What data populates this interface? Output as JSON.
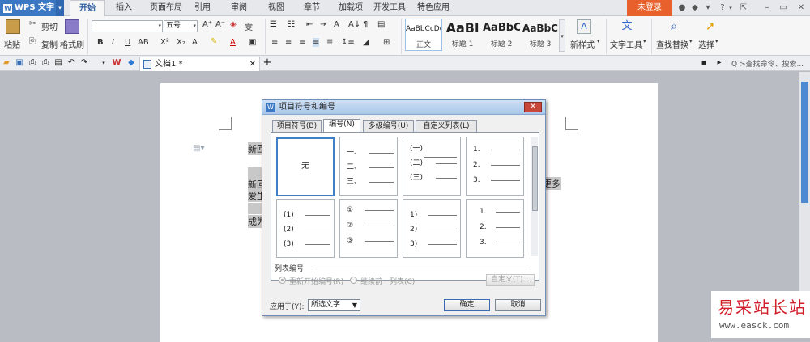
{
  "app": {
    "name": "WPS 文字",
    "tabs": [
      "开始",
      "插入",
      "页面布局",
      "引用",
      "审阅",
      "视图",
      "章节",
      "加载项",
      "开发工具",
      "特色应用"
    ],
    "active_tab": "开始",
    "login_label": "未登录"
  },
  "ribbon": {
    "paste": "粘贴",
    "cut": "剪切",
    "copy": "复制",
    "format_painter": "格式刷",
    "font_name": "",
    "font_size": "五号",
    "bold": "B",
    "italic": "I",
    "underline": "U",
    "styles": [
      {
        "preview": "AaBbCcDd",
        "name": "正文"
      },
      {
        "preview": "AaBl",
        "name": "标题 1"
      },
      {
        "preview": "AaBbC",
        "name": "标题 2"
      },
      {
        "preview": "AaBbC",
        "name": "标题 3"
      }
    ],
    "new_style": "新样式",
    "text_tools": "文字工具",
    "find_replace": "查找替换",
    "select": "选择"
  },
  "docbar": {
    "doc_tab": "文档1 *",
    "search_placeholder": "Q >查找命令、搜索..."
  },
  "page": {
    "paragraphs": [
      "新回",
      "新回",
      "爱生",
      "成为",
      "更多"
    ]
  },
  "dialog": {
    "title": "项目符号和编号",
    "tabs": [
      "项目符号(B)",
      "编号(N)",
      "多级编号(U)",
      "自定义列表(L)"
    ],
    "active_tab": "编号(N)",
    "gallery": [
      {
        "type": "none",
        "label": "无"
      },
      {
        "type": "list",
        "items": [
          "一、",
          "二、",
          "三、"
        ]
      },
      {
        "type": "list",
        "items": [
          "(一)",
          "(二)",
          "(三)"
        ]
      },
      {
        "type": "list",
        "items": [
          "1.",
          "2.",
          "3."
        ]
      },
      {
        "type": "list",
        "items": [
          "(1)",
          "(2)",
          "(3)"
        ]
      },
      {
        "type": "list",
        "items": [
          "①",
          "②",
          "③"
        ]
      },
      {
        "type": "list",
        "items": [
          "1)",
          "2)",
          "3)"
        ]
      },
      {
        "type": "list",
        "items": [
          "1.",
          "2.",
          "3."
        ]
      }
    ],
    "list_numbering_label": "列表编号",
    "restart_label": "重新开始编号(R)",
    "continue_label": "继续前一列表(C)",
    "customize_label": "自定义(T)...",
    "apply_to_label": "应用于(Y):",
    "apply_to_value": "所选文字",
    "ok_label": "确定",
    "cancel_label": "取消"
  },
  "watermark": {
    "cn": "易采站长站",
    "url": "www.easck.com"
  }
}
